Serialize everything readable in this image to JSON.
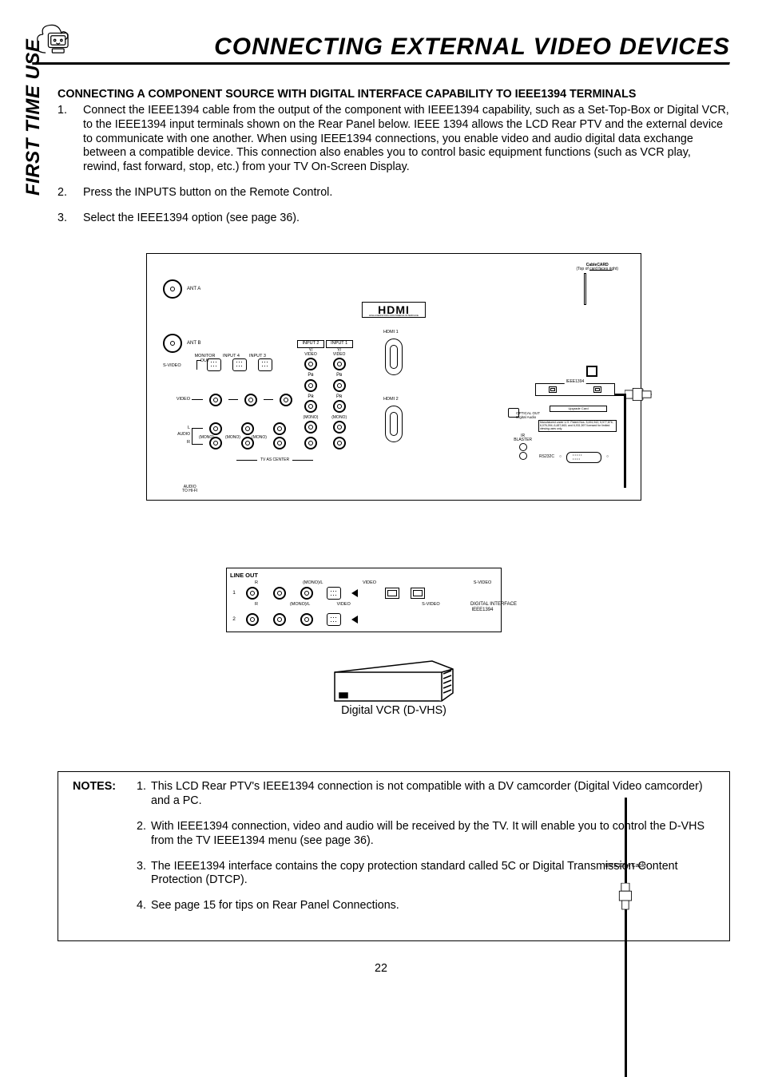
{
  "header": {
    "page_title": "Connecting External Video Devices",
    "side_label": "FIRST TIME USE"
  },
  "section": {
    "heading": "CONNECTING A COMPONENT SOURCE WITH DIGITAL INTERFACE CAPABILITY TO IEEE1394 TERMINALS",
    "steps": [
      "Connect the IEEE1394 cable from the output of the component with IEEE1394 capability, such as a Set-Top-Box or Digital VCR, to the IEEE1394 input terminals shown on the Rear Panel below.  IEEE 1394 allows the LCD Rear PTV and the external device to communicate with one another.  When using IEEE1394 connections, you enable video and audio digital data exchange between a compatible device.  This connection also enables you to control basic equipment functions (such as VCR play, rewind, fast  forward, stop, etc.) from your TV On-Screen Display.",
      "Press the INPUTS button on the Remote Control.",
      "Select the IEEE1394 option (see page 36)."
    ]
  },
  "diagram": {
    "ant_a": "ANT A",
    "ant_b": "ANT B",
    "hdmi_logo_big": "HDMI",
    "hdmi_logo_small": "HIGH-DEFINITION MULTIMEDIA INTERFACE",
    "hdmi1": "HDMI 1",
    "hdmi2": "HDMI 2",
    "input1": "INPUT 1",
    "input2": "INPUT 2",
    "yvideo": "Y/\nVIDEO",
    "pb": "Pʙ",
    "pr": "Pʀ",
    "monitor_out": "MONITOR OUT",
    "input3": "INPUT 3",
    "input4": "INPUT 4",
    "svideo": "S-VIDEO",
    "video": "VIDEO",
    "mono": "(MONO)",
    "audio": "AUDIO",
    "l": "L",
    "r": "R",
    "tv_center": "TV AS CENTER",
    "hifi": "AUDIO\nTO HI-FI",
    "cablecard_b": "CableCARD",
    "cablecard_s": "(Top of card faces right)",
    "ieee1394": "IEEE1394",
    "upgrade": "Upgrade Card",
    "optical": "OPTICAL OUT\nDigital Audio",
    "patents": "Manufatured under U.S. Patent Nos. 5,451,942; 5,977,876; 6,076,094; 6,487,663; and 6,931,597 licensed for limited viewing uses only.",
    "ir": "IR\nBLASTER",
    "rs232c": "RS232C",
    "cable_label": "IEEE1394 Cable",
    "lineout": {
      "head": "LINE OUT",
      "labs": {
        "r": "R",
        "mono": "(MONO)/L",
        "video": "VIDEO",
        "sv": "S-VIDEO"
      },
      "rows": [
        "1",
        "2"
      ],
      "di": "DIGITAL INTERFACE\nIEEE1394"
    },
    "vcr_caption": "Digital VCR (D-VHS)"
  },
  "notes": {
    "label": "NOTES:",
    "items": [
      "This LCD Rear PTV's IEEE1394 connection is not compatible with a DV camcorder (Digital Video camcorder) and a PC.",
      "With IEEE1394 connection, video and audio will be received by the TV.  It will enable you to control the D-VHS from the TV IEEE1394 menu (see page 36).",
      "The IEEE1394 interface contains the copy protection standard called 5C or Digital Transmission Content Protection (DTCP).",
      "See page 15 for tips on Rear Panel Connections."
    ]
  },
  "page_number": "22"
}
